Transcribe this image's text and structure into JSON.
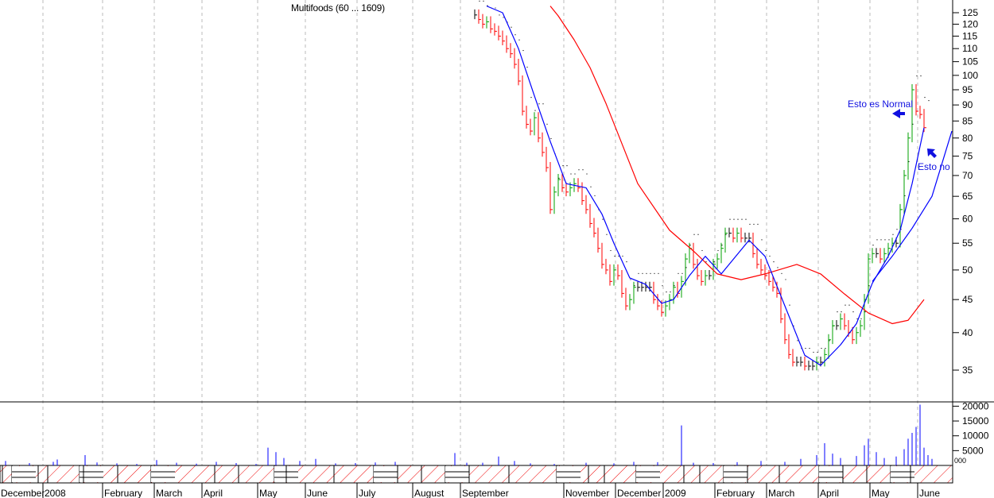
{
  "chart_data": {
    "type": "ohlc-with-moving-averages",
    "title": "Multifoods (60 ... 1609)",
    "x_unit": "trading-day index",
    "price_axis": {
      "scale": "log",
      "range": [
        33,
        128
      ],
      "ticks": [
        125,
        120,
        115,
        110,
        105,
        100,
        95,
        90,
        85,
        80,
        75,
        70,
        65,
        60,
        55,
        50,
        45,
        40,
        35
      ]
    },
    "volume_axis": {
      "range": [
        0,
        22000
      ],
      "ticks": [
        20000,
        15000,
        10000,
        5000
      ],
      "clipped_label": "000"
    },
    "x_tick_labels": [
      {
        "label": "December",
        "day": -119
      },
      {
        "label": "2008",
        "day": -108
      },
      {
        "label": "February",
        "day": -93
      },
      {
        "label": "March",
        "day": -80
      },
      {
        "label": "April",
        "day": -68
      },
      {
        "label": "May",
        "day": -54
      },
      {
        "label": "June",
        "day": -42
      },
      {
        "label": "July",
        "day": -29
      },
      {
        "label": "August",
        "day": -15
      },
      {
        "label": "September",
        "day": -3
      },
      {
        "label": "November",
        "day": 23
      },
      {
        "label": "December",
        "day": 36
      },
      {
        "label": "2009",
        "day": 48
      },
      {
        "label": "February",
        "day": 61
      },
      {
        "label": "March",
        "day": 74
      },
      {
        "label": "April",
        "day": 87
      },
      {
        "label": "May",
        "day": 100
      },
      {
        "label": "June",
        "day": 112
      }
    ],
    "closes": [
      124,
      122,
      120,
      121,
      118,
      117,
      115,
      113,
      110,
      108,
      104,
      98,
      88,
      84,
      82,
      86,
      80,
      76,
      72,
      62,
      66,
      69,
      67,
      66,
      67,
      68,
      67,
      64,
      62,
      59,
      57,
      54,
      51,
      50,
      48,
      50,
      49,
      46,
      44,
      45,
      47,
      47,
      47,
      47,
      47,
      45,
      44,
      43,
      44,
      45,
      47,
      46,
      48,
      52,
      54,
      51,
      49,
      48,
      49,
      49,
      51,
      52,
      54,
      57,
      57,
      56,
      57,
      56,
      56,
      56,
      53,
      51,
      50,
      49,
      48,
      47,
      46,
      42,
      39,
      37,
      36,
      36,
      36,
      35.5,
      35.5,
      35.5,
      36,
      36,
      37,
      39,
      41,
      41,
      42,
      41,
      40,
      39,
      40,
      41,
      45,
      52,
      53,
      53,
      52,
      53,
      54,
      55,
      55,
      62,
      70,
      80,
      95,
      88,
      87,
      83
    ],
    "ma_short": [
      [
        3,
        128
      ],
      [
        7,
        125
      ],
      [
        11,
        110
      ],
      [
        15,
        93
      ],
      [
        19,
        79
      ],
      [
        23,
        68
      ],
      [
        28,
        67
      ],
      [
        32,
        61
      ],
      [
        35,
        55
      ],
      [
        39,
        48.6
      ],
      [
        43,
        47.5
      ],
      [
        47,
        44.4
      ],
      [
        50,
        45
      ],
      [
        54,
        49
      ],
      [
        58,
        52.5
      ],
      [
        62,
        49.3
      ],
      [
        69,
        55.6
      ],
      [
        73,
        52.5
      ],
      [
        78,
        44
      ],
      [
        83,
        36.9
      ],
      [
        87,
        35.6
      ],
      [
        92,
        38.3
      ],
      [
        96,
        41.3
      ],
      [
        100,
        47.7
      ],
      [
        104,
        52.5
      ],
      [
        107,
        57.6
      ],
      [
        110,
        68
      ],
      [
        113,
        83
      ]
    ],
    "ma_mid": [
      [
        100,
        48
      ],
      [
        105,
        52.5
      ],
      [
        110,
        58
      ],
      [
        115,
        65
      ],
      [
        120,
        82
      ]
    ],
    "ma_long": [
      [
        19,
        128
      ],
      [
        21,
        123.6
      ],
      [
        25,
        113.5
      ],
      [
        29,
        102.8
      ],
      [
        33,
        90.5
      ],
      [
        41,
        68
      ],
      [
        49,
        57.6
      ],
      [
        55,
        53.5
      ],
      [
        61,
        49.3
      ],
      [
        67,
        48.3
      ],
      [
        73,
        49.3
      ],
      [
        81,
        51
      ],
      [
        87,
        49.3
      ],
      [
        93,
        45.9
      ],
      [
        99,
        42.9
      ],
      [
        105,
        41.3
      ],
      [
        109,
        41.8
      ],
      [
        113,
        45
      ]
    ],
    "volume": [
      [
        -118,
        1500
      ],
      [
        -112,
        800
      ],
      [
        -106,
        1200
      ],
      [
        -105,
        2000
      ],
      [
        -98,
        3500
      ],
      [
        -95,
        1000
      ],
      [
        -90,
        700
      ],
      [
        -85,
        500
      ],
      [
        -80,
        1800
      ],
      [
        -75,
        900
      ],
      [
        -70,
        600
      ],
      [
        -65,
        1200
      ],
      [
        -60,
        800
      ],
      [
        -55,
        500
      ],
      [
        -52,
        6000
      ],
      [
        -50,
        4500
      ],
      [
        -48,
        2500
      ],
      [
        -44,
        1500
      ],
      [
        -40,
        2200
      ],
      [
        -35,
        700
      ],
      [
        -30,
        800
      ],
      [
        -25,
        1000
      ],
      [
        -20,
        1200
      ],
      [
        -5,
        4200
      ],
      [
        -2,
        900
      ],
      [
        2,
        900
      ],
      [
        6,
        3000
      ],
      [
        10,
        1500
      ],
      [
        14,
        700
      ],
      [
        20,
        500
      ],
      [
        28,
        900
      ],
      [
        35,
        700
      ],
      [
        40,
        1200
      ],
      [
        46,
        1100
      ],
      [
        52,
        13500
      ],
      [
        55,
        900
      ],
      [
        60,
        800
      ],
      [
        66,
        1100
      ],
      [
        72,
        1500
      ],
      [
        78,
        1200
      ],
      [
        82,
        2200
      ],
      [
        86,
        3500
      ],
      [
        88,
        7500
      ],
      [
        90,
        4000
      ],
      [
        92,
        2500
      ],
      [
        96,
        3200
      ],
      [
        98,
        6800
      ],
      [
        99,
        9000
      ],
      [
        101,
        4500
      ],
      [
        103,
        2500
      ],
      [
        106,
        3000
      ],
      [
        108,
        5500
      ],
      [
        109,
        9000
      ],
      [
        110,
        11000
      ],
      [
        111,
        13000
      ],
      [
        112,
        20500
      ],
      [
        113,
        6000
      ],
      [
        114,
        3500
      ],
      [
        115,
        2200
      ]
    ],
    "annotations": {
      "normal": "Esto es Normal",
      "not_normal": "Esto no"
    },
    "colors": {
      "up": "#00a000",
      "down": "#ff0000",
      "neutral": "#000000",
      "ma_short": "#0000ff",
      "ma_long": "#ff0000",
      "volume": "#0000ff"
    }
  }
}
